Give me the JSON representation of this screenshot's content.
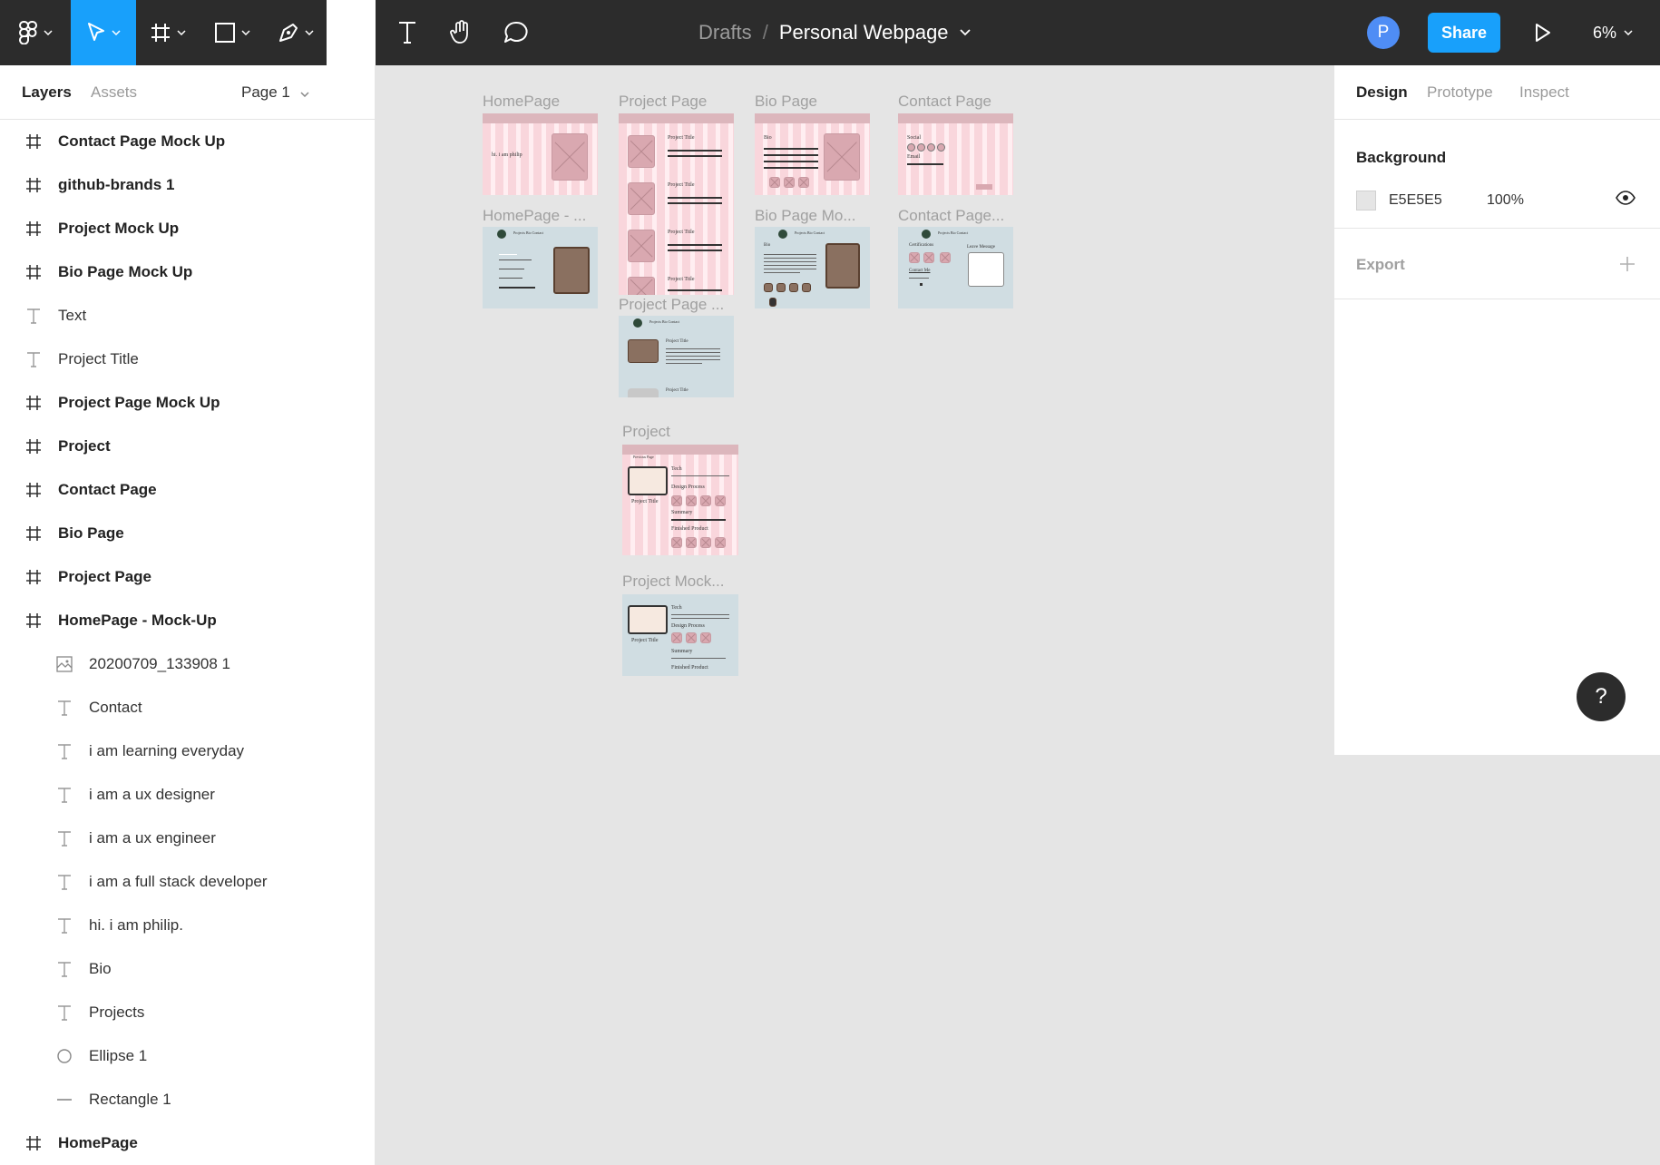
{
  "toolbar": {
    "breadcrumb_parent": "Drafts",
    "breadcrumb_sep": "/",
    "file_title": "Personal Webpage",
    "avatar_initial": "P",
    "share_label": "Share",
    "zoom_level": "6%",
    "accent_color": "#18a0fb",
    "tools": [
      "figma-menu-icon",
      "move-tool-icon",
      "frame-tool-icon",
      "shape-tool-icon",
      "pen-tool-icon",
      "text-tool-icon",
      "hand-tool-icon",
      "comment-tool-icon"
    ]
  },
  "layers_panel": {
    "tab_layers": "Layers",
    "tab_assets": "Assets",
    "page_select": "Page 1",
    "items": [
      {
        "label": "Contact Page Mock Up",
        "type": "frame"
      },
      {
        "label": "github-brands 1",
        "type": "frame"
      },
      {
        "label": "Project Mock Up",
        "type": "frame"
      },
      {
        "label": "Bio Page Mock Up",
        "type": "frame"
      },
      {
        "label": "Text",
        "type": "text"
      },
      {
        "label": "Project Title",
        "type": "text"
      },
      {
        "label": "Project Page Mock Up",
        "type": "frame"
      },
      {
        "label": "Project",
        "type": "frame"
      },
      {
        "label": "Contact Page",
        "type": "frame"
      },
      {
        "label": "Bio Page",
        "type": "frame"
      },
      {
        "label": "Project Page",
        "type": "frame"
      },
      {
        "label": "HomePage - Mock-Up",
        "type": "frame"
      },
      {
        "label": "20200709_133908 1",
        "type": "image"
      },
      {
        "label": "Contact",
        "type": "text"
      },
      {
        "label": "i am learning everyday",
        "type": "text"
      },
      {
        "label": "i am a ux designer",
        "type": "text"
      },
      {
        "label": "i am a ux engineer",
        "type": "text"
      },
      {
        "label": "i am a full stack developer",
        "type": "text"
      },
      {
        "label": "hi. i am philip.",
        "type": "text"
      },
      {
        "label": "Bio",
        "type": "text"
      },
      {
        "label": "Projects",
        "type": "text"
      },
      {
        "label": "Ellipse 1",
        "type": "ellipse"
      },
      {
        "label": "Rectangle 1",
        "type": "line"
      },
      {
        "label": "HomePage",
        "type": "frame"
      }
    ]
  },
  "canvas": {
    "background": "#e5e5e5",
    "frames": {
      "homepage": "HomePage",
      "project_page": "Project Page",
      "bio_page": "Bio Page",
      "contact_page": "Contact Page",
      "homepage_mock": "HomePage - ...",
      "bio_mock": "Bio Page Mo...",
      "contact_mock": "Contact Page...",
      "project_page_mock": "Project Page ...",
      "project": "Project",
      "project_mock": "Project Mock..."
    },
    "thumb_text": {
      "hi": "hi. i am philip",
      "nav": "Projects  Bio  Contact",
      "project_title": "Project Title",
      "tech_used": "Tech Used",
      "bio": "Bio",
      "social": "Social",
      "email": "Email",
      "certifications": "Certifications",
      "contact_me": "Contact Me",
      "leave_message": "Leave Message",
      "tech": "Tech",
      "design_process": "Design Process",
      "summary": "Summary",
      "finished_product": "Finished Product",
      "previous_page": "Previous Page"
    }
  },
  "design_panel": {
    "tab_design": "Design",
    "tab_prototype": "Prototype",
    "tab_inspect": "Inspect",
    "background_title": "Background",
    "background_hex": "E5E5E5",
    "background_opacity": "100%",
    "export_title": "Export"
  },
  "help_label": "?"
}
